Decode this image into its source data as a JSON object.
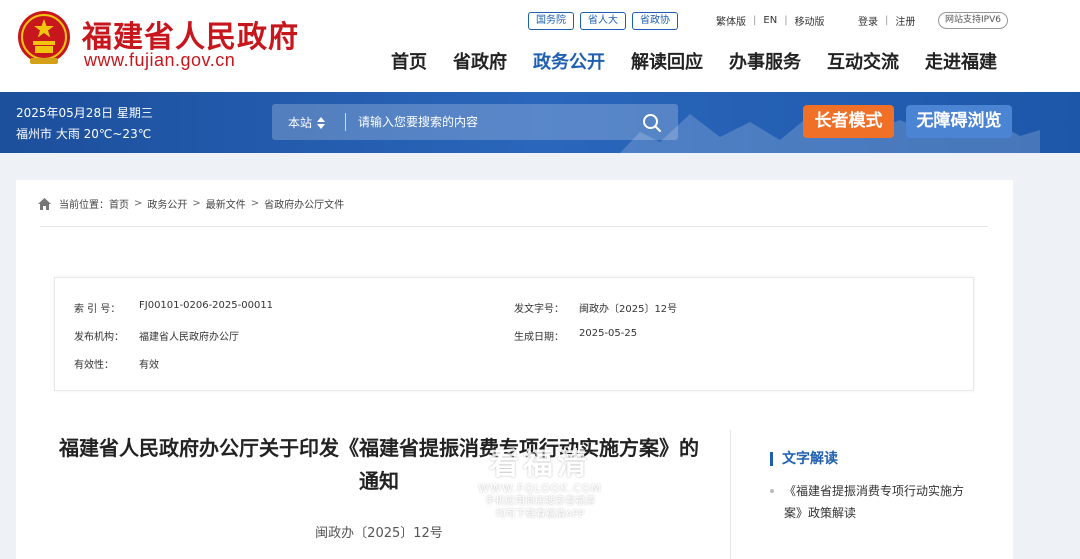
{
  "header": {
    "site_title": "福建省人民政府",
    "site_url": "www.fujian.gov.cn",
    "top_links": [
      "国务院",
      "省人大",
      "省政协"
    ],
    "lang_links": [
      "繁体版",
      "EN",
      "移动版"
    ],
    "account_links": [
      "登录",
      "注册"
    ],
    "ipv6_badge": "网站支持IPV6",
    "nav": [
      "首页",
      "省政府",
      "政务公开",
      "解读回应",
      "办事服务",
      "互动交流",
      "走进福建"
    ],
    "nav_active": "政务公开"
  },
  "banner": {
    "date": "2025年05月28日 星期三",
    "weather": "福州市 大雨 20℃~23℃",
    "search_scope": "本站",
    "search_placeholder": "请输入您要搜索的内容",
    "elder_mode": "长者模式",
    "accessible": "无障碍浏览"
  },
  "breadcrumb": {
    "prefix": "当前位置：",
    "items": [
      "首页",
      "政务公开",
      "最新文件",
      "省政府办公厅文件"
    ]
  },
  "meta": {
    "index_label": "索 引 号：",
    "index_value": "FJ00101-0206-2025-00011",
    "docnum_label": "发文字号：",
    "docnum_value": "闽政办〔2025〕12号",
    "issuer_label": "发布机构：",
    "issuer_value": "福建省人民政府办公厅",
    "date_label": "生成日期：",
    "date_value": "2025-05-25",
    "validity_label": "有效性：",
    "validity_value": "有效"
  },
  "article": {
    "title": "福建省人民政府办公厅关于印发《福建省提振消费专项行动实施方案》的通知",
    "doc_number": "闽政办〔2025〕12号"
  },
  "sidebar": {
    "heading": "文字解读",
    "links": [
      "《福建省提振消费专项行动实施方案》政策解读"
    ]
  },
  "watermark": {
    "brand": "看福清",
    "url": "WWW.FQLOOK.COM",
    "line1": "手机应用商店搜索看福清",
    "line2": "均可下载看福清APP"
  },
  "colors": {
    "brand_red": "#c8161d",
    "accent_blue": "#1f5fb0",
    "elder_orange": "#f07028",
    "access_blue": "#4b84d3"
  }
}
